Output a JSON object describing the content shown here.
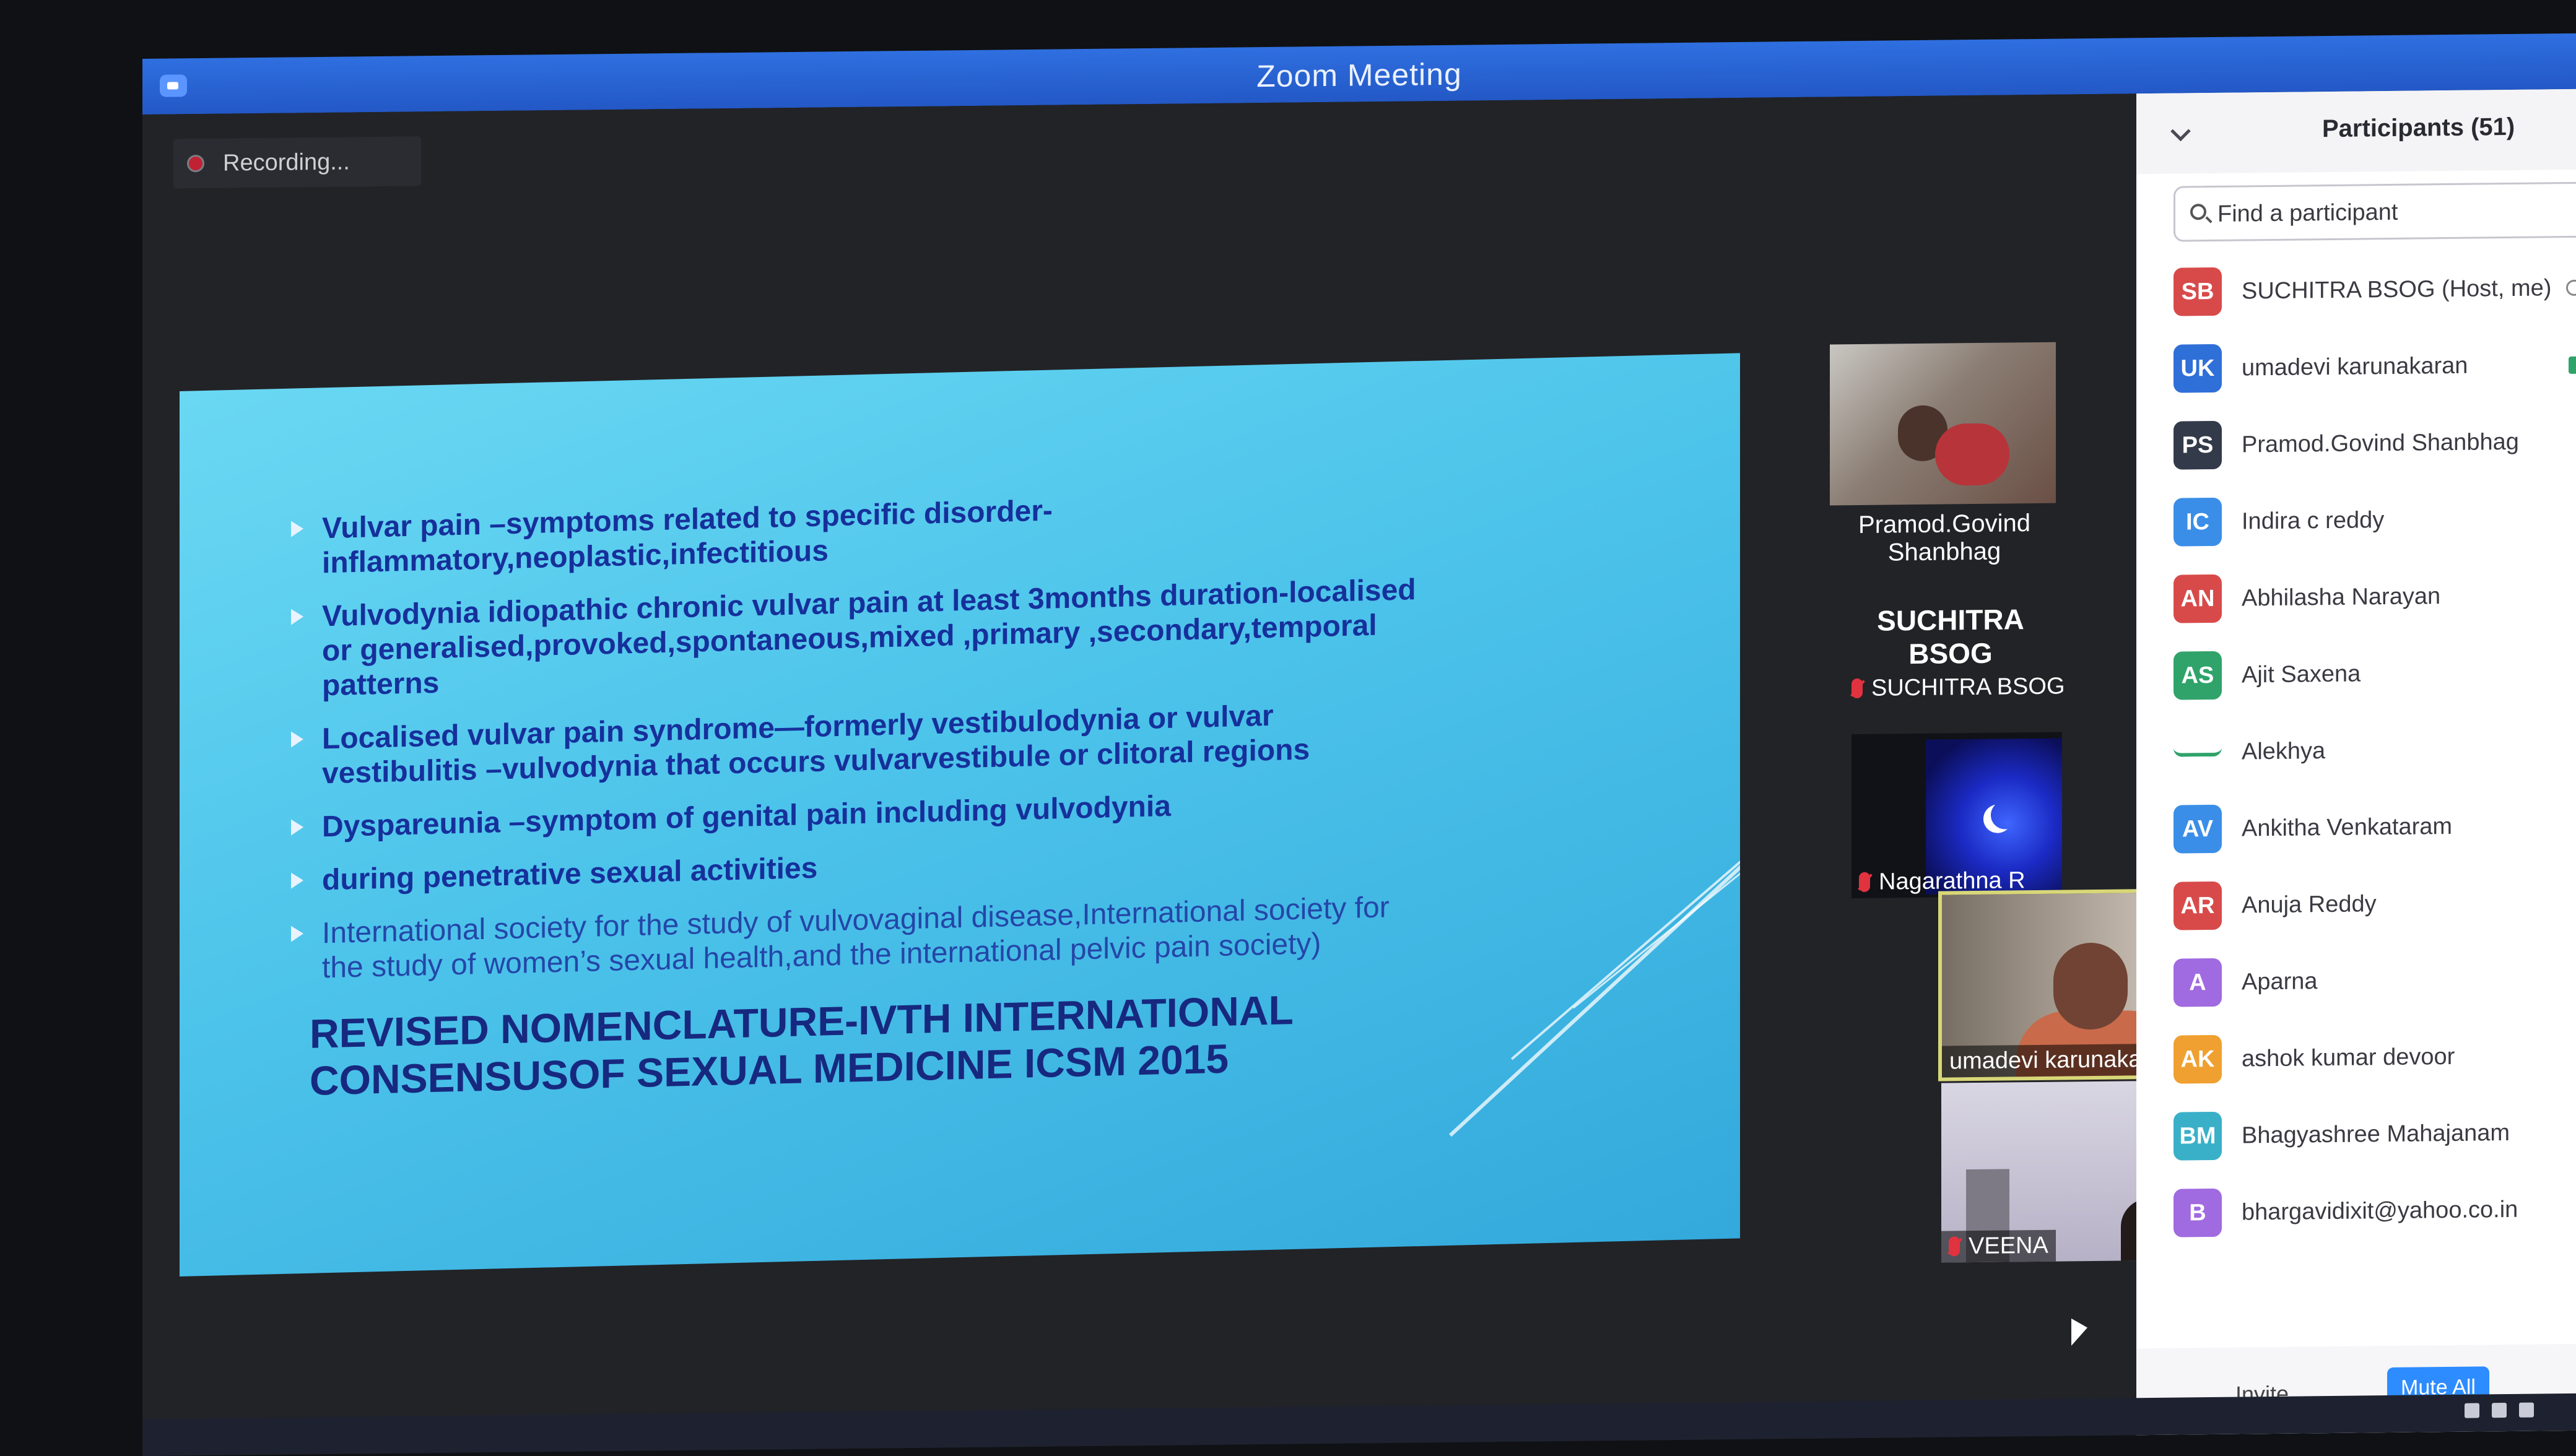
{
  "window": {
    "title": "Zoom Meeting"
  },
  "recording": {
    "label": "Recording..."
  },
  "slide": {
    "bullets": [
      "Vulvar pain –symptoms related to specific disorder-inflammatory,neoplastic,infectitious",
      "Vulvodynia idiopathic chronic vulvar pain at least 3months duration-localised or generalised,provoked,spontaneous,mixed ,primary ,secondary,temporal patterns",
      "Localised vulvar pain syndrome—formerly vestibulodynia or vulvar vestibulitis –vulvodynia that occurs vulvarvestibule or clitoral regions",
      "Dyspareunia –symptom of genital pain including vulvodynia",
      " during penetrative sexual activities",
      "International society for the study of vulvovaginal disease,International society for the study of women’s sexual health,and the international pelvic pain society)"
    ],
    "heading": "REVISED NOMENCLATURE-IVTH INTERNATIONAL CONSENSUSOF SEXUAL MEDICINE ICSM 2015"
  },
  "videos": {
    "pramod": "Pramod.Govind Shanbhag",
    "suchitra_big": "SUCHITRA BSOG",
    "suchitra_label": "SUCHITRA BSOG",
    "nagarathna": "Nagarathna R",
    "umadevi": "umadevi karunakaran",
    "veena": "VEENA"
  },
  "participants": {
    "title": "Participants (51)",
    "search_placeholder": "Find a participant",
    "list": [
      {
        "initials": "SB",
        "name": "SUCHITRA BSOG (Host, me)",
        "color": "#d84a4a"
      },
      {
        "initials": "UK",
        "name": "umadevi karunakaran",
        "color": "#2f6fd8"
      },
      {
        "initials": "PS",
        "name": "Pramod.Govind Shanbhag",
        "color": "#333a4a"
      },
      {
        "initials": "IC",
        "name": "Indira c reddy",
        "color": "#3a8ee8"
      },
      {
        "initials": "AN",
        "name": "Abhilasha Narayan",
        "color": "#d84a4a"
      },
      {
        "initials": "AS",
        "name": "Ajit Saxena",
        "color": "#2fa36a"
      },
      {
        "initials": "",
        "name": "Alekhya",
        "color": "#2fa36a"
      },
      {
        "initials": "AV",
        "name": "Ankitha Venkataram",
        "color": "#3a8ee8"
      },
      {
        "initials": "AR",
        "name": "Anuja Reddy",
        "color": "#d84a4a"
      },
      {
        "initials": "A",
        "name": "Aparna",
        "color": "#a06ae0"
      },
      {
        "initials": "AK",
        "name": "ashok kumar devoor",
        "color": "#f0a030"
      },
      {
        "initials": "BM",
        "name": "Bhagyashree Mahajanam",
        "color": "#3ab0c8"
      },
      {
        "initials": "B",
        "name": "bhargavidixit@yahoo.co.in",
        "color": "#a06ae0"
      }
    ],
    "invite_label": "Invite",
    "mute_all_label": "Mute All"
  }
}
